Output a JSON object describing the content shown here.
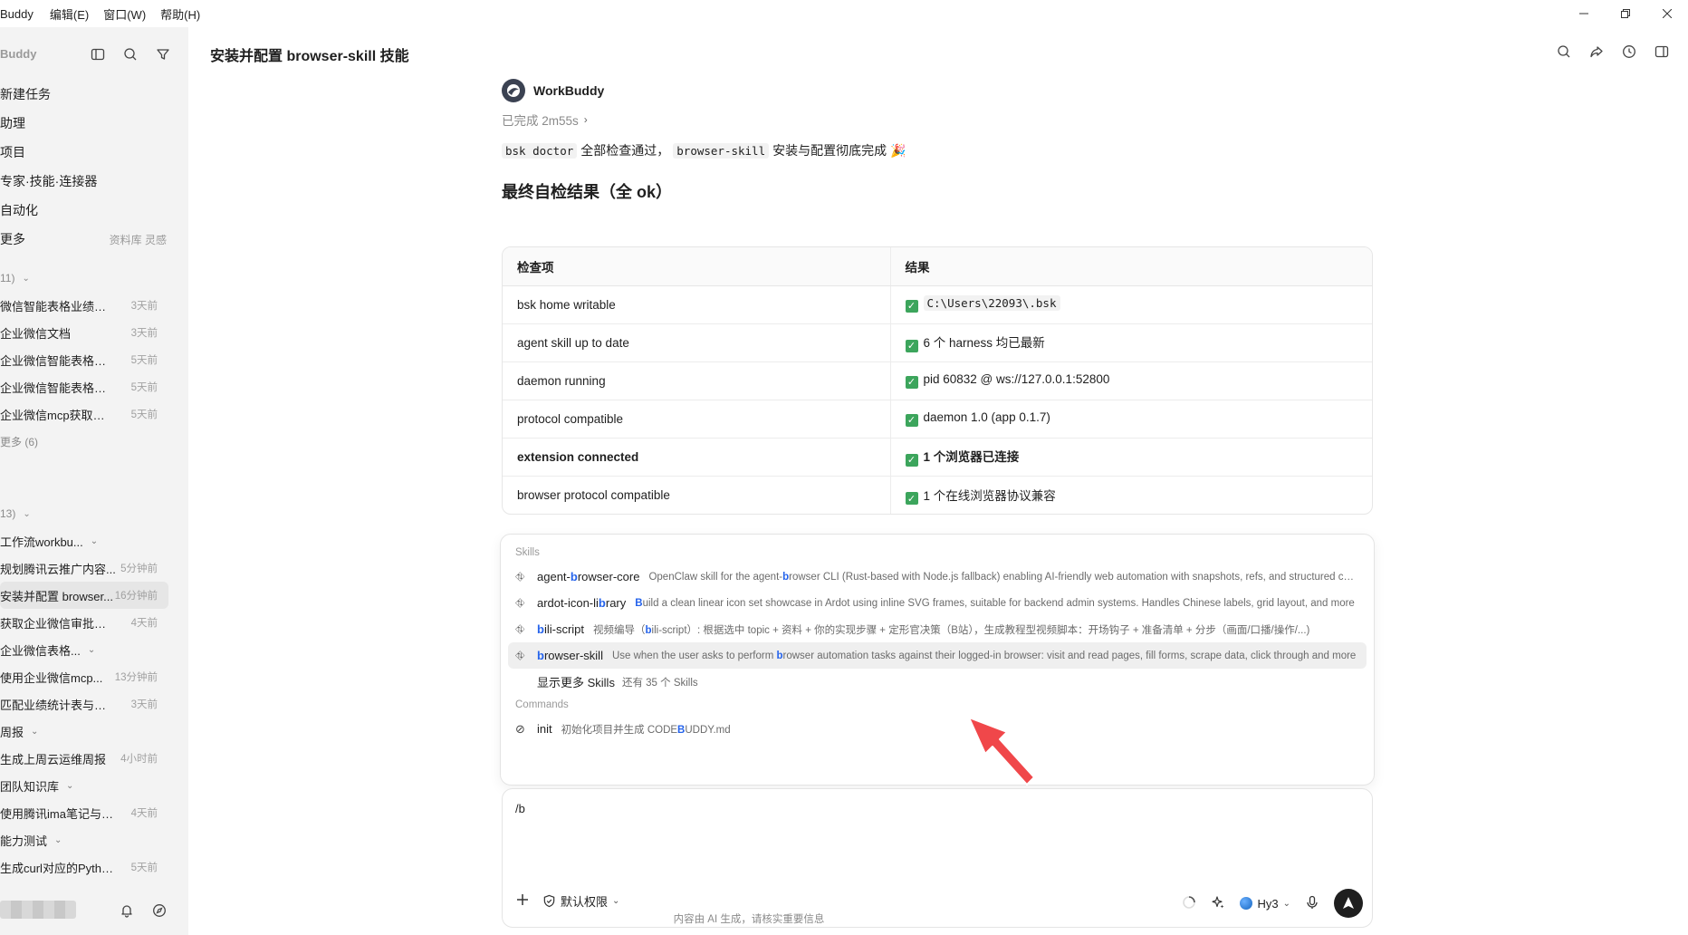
{
  "menubar": {
    "app_name": "Buddy",
    "menus": [
      "编辑(E)",
      "窗口(W)",
      "帮助(H)"
    ]
  },
  "sidebar": {
    "brand": "Buddy",
    "nav": [
      {
        "label": "新建任务",
        "extra": ""
      },
      {
        "label": "助理",
        "extra": ""
      },
      {
        "label": "项目",
        "extra": ""
      },
      {
        "label": "专家·技能·连接器",
        "extra": ""
      },
      {
        "label": "自动化",
        "extra": ""
      },
      {
        "label": "更多",
        "extra": "资料库  灵感"
      }
    ],
    "group1_head": "11)",
    "group1_items": [
      {
        "label": "微信智能表格业绩汇总",
        "time": "3天前"
      },
      {
        "label": "企业微信文档",
        "time": "3天前"
      },
      {
        "label": "企业微信智能表格数据",
        "time": "5天前"
      },
      {
        "label": "企业微信智能表格信息",
        "time": "5天前"
      },
      {
        "label": "企业微信mcp获取在线...",
        "time": "5天前"
      }
    ],
    "group1_more": "更多 (6)",
    "group2_head": "13)",
    "group2_items": [
      {
        "label": "工作流workbu...",
        "time": "",
        "chev": true
      },
      {
        "label": "规划腾讯云推广内容...",
        "time": "5分钟前"
      },
      {
        "label": "安装并配置 browser...",
        "time": "16分钟前",
        "active": true
      },
      {
        "label": "获取企业微信审批信息",
        "time": "4天前"
      },
      {
        "label": "企业微信表格...",
        "time": "",
        "chev": true
      },
      {
        "label": "使用企业微信mcp...",
        "time": "13分钟前"
      },
      {
        "label": "匹配业绩统计表与跟进...",
        "time": "3天前"
      },
      {
        "label": "周报",
        "time": "",
        "chev": true
      },
      {
        "label": "生成上周云运维周报",
        "time": "4小时前"
      },
      {
        "label": "团队知识库",
        "time": "",
        "chev": true
      },
      {
        "label": "使用腾讯ima笔记与知...",
        "time": "4天前"
      },
      {
        "label": "能力测试",
        "time": "",
        "chev": true
      },
      {
        "label": "生成curl对应的Python...",
        "time": "5天前"
      }
    ]
  },
  "main": {
    "title": "安装并配置 browser-skill 技能",
    "bot_name": "WorkBuddy",
    "status": "已完成 2m55s",
    "summary": {
      "code1": "bsk doctor",
      "text1": "全部检查通过，",
      "code2": "browser-skill",
      "text2": "安装与配置彻底完成 🎉"
    },
    "heading": "最终自检结果（全 ok）",
    "table": {
      "headers": [
        "检查项",
        "结果"
      ],
      "rows": [
        {
          "item": "bsk home writable",
          "result": "C:\\Users\\22093\\.bsk",
          "mono": true
        },
        {
          "item": "agent skill up to date",
          "result": "6 个 harness 均已最新"
        },
        {
          "item": "daemon running",
          "result": "pid 60832 @ ws://127.0.0.1:52800"
        },
        {
          "item": "protocol compatible",
          "result": "daemon 1.0 (app 0.1.7)"
        },
        {
          "item": "extension connected",
          "result": "1 个浏览器已连接",
          "bold": true
        },
        {
          "item": "browser protocol compatible",
          "result": "1 个在线浏览器协议兼容"
        }
      ]
    }
  },
  "popup": {
    "skills_label": "Skills",
    "skills": [
      {
        "pre": "agent-",
        "hl": "b",
        "post": "rowser-core",
        "desc_pre": "OpenClaw skill for the agent-",
        "desc_hl": "b",
        "desc_post": "rowser CLI (Rust-based with Node.js fallback) enabling AI-friendly web automation with snapshots, refs, and structured commands"
      },
      {
        "pre": "ardot-icon-li",
        "hl": "b",
        "post": "rary",
        "desc_pre": "",
        "desc_hl": "B",
        "desc_post": "uild a clean linear icon set showcase in Ardot using inline SVG frames, suitable for backend admin systems. Handles Chinese labels, grid layout, and more"
      },
      {
        "pre": "",
        "hl": "b",
        "post": "ili-script",
        "desc_pre": "视频编导（",
        "desc_hl": "b",
        "desc_post": "ili-script）: 根据选中 topic + 资料 + 你的实现步骤 + 定形官决策（B站），生成教程型视频脚本：开场钩子 + 准备清单 + 分步（画面/口播/操作/...)"
      },
      {
        "pre": "",
        "hl": "b",
        "post": "rowser-skill",
        "desc_pre": "Use when the user asks to perform ",
        "desc_hl": "b",
        "desc_post": "rowser automation tasks against their logged-in browser: visit and read pages, fill forms, scrape data, click through and more",
        "active": true
      }
    ],
    "show_more": "显示更多 Skills",
    "show_more_count": "还有 35 个 Skills",
    "commands_label": "Commands",
    "command": {
      "name": "init",
      "desc_pre": "初始化项目并生成 CODE",
      "desc_hl": "B",
      "desc_post": "UDDY.md"
    }
  },
  "input": {
    "value": "/b",
    "permission": "默认权限",
    "model": "Hy3"
  },
  "footer": "内容由 AI 生成，请核实重要信息",
  "colors": {
    "accent": "#2563eb",
    "check": "#3ca55c",
    "arrow": "#f0474a"
  }
}
